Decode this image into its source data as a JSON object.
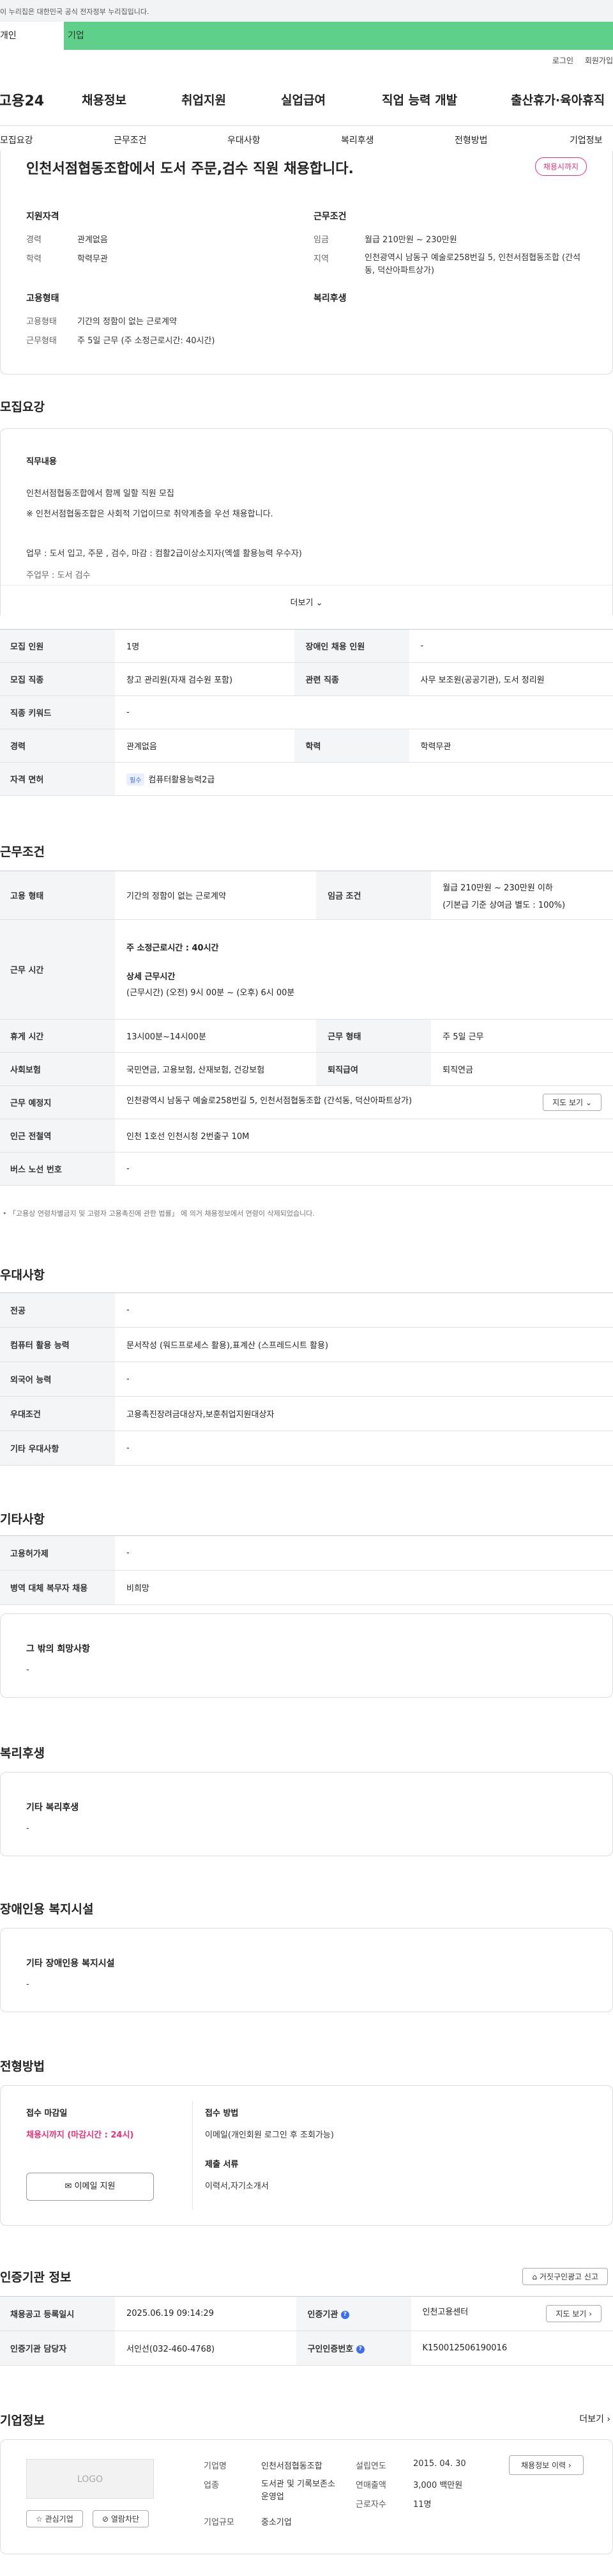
{
  "gov_banner": "이 누리집은 대한민국 공식 전자정부 누리집입니다.",
  "tabs": [
    "개인",
    "기업"
  ],
  "util": [
    "로그인",
    "회원가입"
  ],
  "gnb": {
    "logo": "고용24",
    "menu": [
      "채용정보",
      "취업지원",
      "실업급여",
      "직업 능력 개발",
      "출산휴가·육아휴직"
    ]
  },
  "anchor_nav": [
    "모집요강",
    "근무조건",
    "우대사항",
    "복리후생",
    "전형방법",
    "기업정보"
  ],
  "summary": {
    "title": "인천서점협동조합에서 도서 주문,검수 직원 채용합니다.",
    "status_badge": "채용시까지",
    "qual_heading": "지원자격",
    "qual": [
      {
        "k": "경력",
        "v": "관계없음"
      },
      {
        "k": "학력",
        "v": "학력무관"
      }
    ],
    "emp_heading": "고용형태",
    "emp": [
      {
        "k": "고용형태",
        "v": "기간의 정함이 없는 근로계약"
      },
      {
        "k": "근무형태",
        "v": "주 5일 근무 (주 소정근로시간: 40시간)"
      }
    ],
    "cond_heading": "근무조건",
    "cond": [
      {
        "k": "임금",
        "v": "월급 210만원 ~ 230만원"
      },
      {
        "k": "지역",
        "v": "인천광역시 남동구 예술로258번길 5, 인천서점협동조합 (간석동, 덕산아파트상가)"
      }
    ],
    "welfare_heading": "복리후생"
  },
  "recruit": {
    "heading": "모집요강",
    "duty_heading": "직무내용",
    "duty_lines": [
      "인천서점협동조합에서 함께 일할 직원 모집",
      "※ 인천서점협동조합은 사회적 기업이므로 취약계층을 우선 채용합니다.",
      "업무 : 도서 입고, 주문 , 검수, 마감 : 컴활2급이상소지자(엑셀 활용능력 우수자)",
      "주업무 : 도서 검수"
    ],
    "more": "더보기",
    "rows": [
      {
        "a": "모집 인원",
        "b": "1명",
        "c": "장애인 채용 인원",
        "d": "-"
      },
      {
        "a": "모집 직종",
        "b": "창고 관리원(자재 검수원 포함)",
        "c": "관련 직종",
        "d": "사무 보조원(공공기관), 도서 정리원"
      },
      {
        "a": "직종 키워드",
        "b": "-"
      },
      {
        "a": "경력",
        "b": "관계없음",
        "c": "학력",
        "d": "학력무관"
      },
      {
        "a": "자격 면허",
        "badge": "필수",
        "b": "컴퓨터활용능력2급"
      }
    ]
  },
  "work": {
    "heading": "근무조건",
    "emp_type_k": "고용 형태",
    "emp_type_v": "기간의 정함이 없는 근로계약",
    "wage_k": "임금 조건",
    "wage_v1": "월급 210만원 ~ 230만원 이하",
    "wage_v2": "(기본급 기준 상여금 별도 : 100%)",
    "time_k": "근무 시간",
    "time_week": "주 소정근로시간 : 40시간",
    "time_detail_label": "상세 근무시간",
    "time_detail": "(근무시간) (오전) 9시 00분 ~ (오후) 6시 00분",
    "rest_k": "휴게 시간",
    "rest_v": "13시00분~14시00분",
    "form_k": "근무 형태",
    "form_v": "주 5일 근무",
    "ins_k": "사회보험",
    "ins_v": "국민연금, 고용보험, 산재보험, 건강보험",
    "ret_k": "퇴직급여",
    "ret_v": "퇴직연금",
    "place_k": "근무 예정지",
    "place_v": "인천광역시 남동구 예술로258번길 5, 인천서점협동조합 (간석동, 덕산아파트상가)",
    "map_btn": "지도 보기",
    "sub_k": "인근 전철역",
    "sub_v": "인천 1호선 인천시청 2번출구 10M",
    "bus_k": "버스 노선 번호",
    "bus_v": "-",
    "note": "「고용상 연령차별금지 및 고령자 고용촉진에 관한 법률」 에 의거 채용정보에서 연령이 삭제되었습니다."
  },
  "pref": {
    "heading": "우대사항",
    "rows": [
      {
        "k": "전공",
        "v": "-"
      },
      {
        "k": "컴퓨터 활용 능력",
        "v": "문서작성 (워드프로세스 활용),표계산 (스프레드시트 활용)"
      },
      {
        "k": "외국어 능력",
        "v": "-"
      },
      {
        "k": "우대조건",
        "v": "고용촉진장려금대상자,보훈취업지원대상자"
      },
      {
        "k": "기타 우대사항",
        "v": "-"
      }
    ]
  },
  "etc": {
    "heading": "기타사항",
    "rows": [
      {
        "k": "고용허가제",
        "v": "-"
      },
      {
        "k": "병역 대체 복무자 채용",
        "v": "비희망"
      }
    ],
    "other_heading": "그 밖의 희망사항",
    "other_v": "-"
  },
  "welfare": {
    "heading": "복리후생",
    "sub": "기타 복리후생",
    "v": "-"
  },
  "disabled": {
    "heading": "장애인용 복지시설",
    "sub": "기타 장애인용 복지시설",
    "v": "-"
  },
  "process": {
    "heading": "전형방법",
    "deadline_label": "접수 마감일",
    "deadline_v": "채용시까지 (마감시간 : 24시)",
    "apply_btn": "이메일 지원",
    "method_label": "접수 방법",
    "method_v": "이메일(개인회원 로그인 후 조회가능)",
    "docs_label": "제출 서류",
    "docs_v": "이력서,자기소개서"
  },
  "agency": {
    "heading": "인증기관 정보",
    "report_btn": "거짓구인광고 신고",
    "rows": [
      {
        "a": "채용공고 등록일시",
        "b": "2025.06.19 09:14:29",
        "c": "인증기관",
        "d": "인천고용센터",
        "btn": "지도 보기"
      },
      {
        "a": "인증기관 담당자",
        "b": "서인선(032-460-4768)",
        "c": "구인인증번호",
        "d": "K150012506190016"
      }
    ]
  },
  "company": {
    "heading": "기업정보",
    "more": "더보기",
    "logo": "LOGO",
    "fav_btn": "관심기업",
    "block_btn": "열람차단",
    "fields": [
      {
        "k": "기업명",
        "v": "인천서점협동조합"
      },
      {
        "k": "업종",
        "v": "도서관 및 기록보존소 운영업"
      },
      {
        "k": "기업규모",
        "v": "중소기업"
      },
      {
        "k": "설립연도",
        "v": "2015. 04. 30"
      },
      {
        "k": "연매출액",
        "v": "3,000 백만원"
      },
      {
        "k": "근로자수",
        "v": "11명"
      }
    ],
    "jobs_btn": "채용정보 이력"
  },
  "colors": {
    "accent": "#5fd08a",
    "status": "#e9317a",
    "info": "#3b6ef0"
  }
}
